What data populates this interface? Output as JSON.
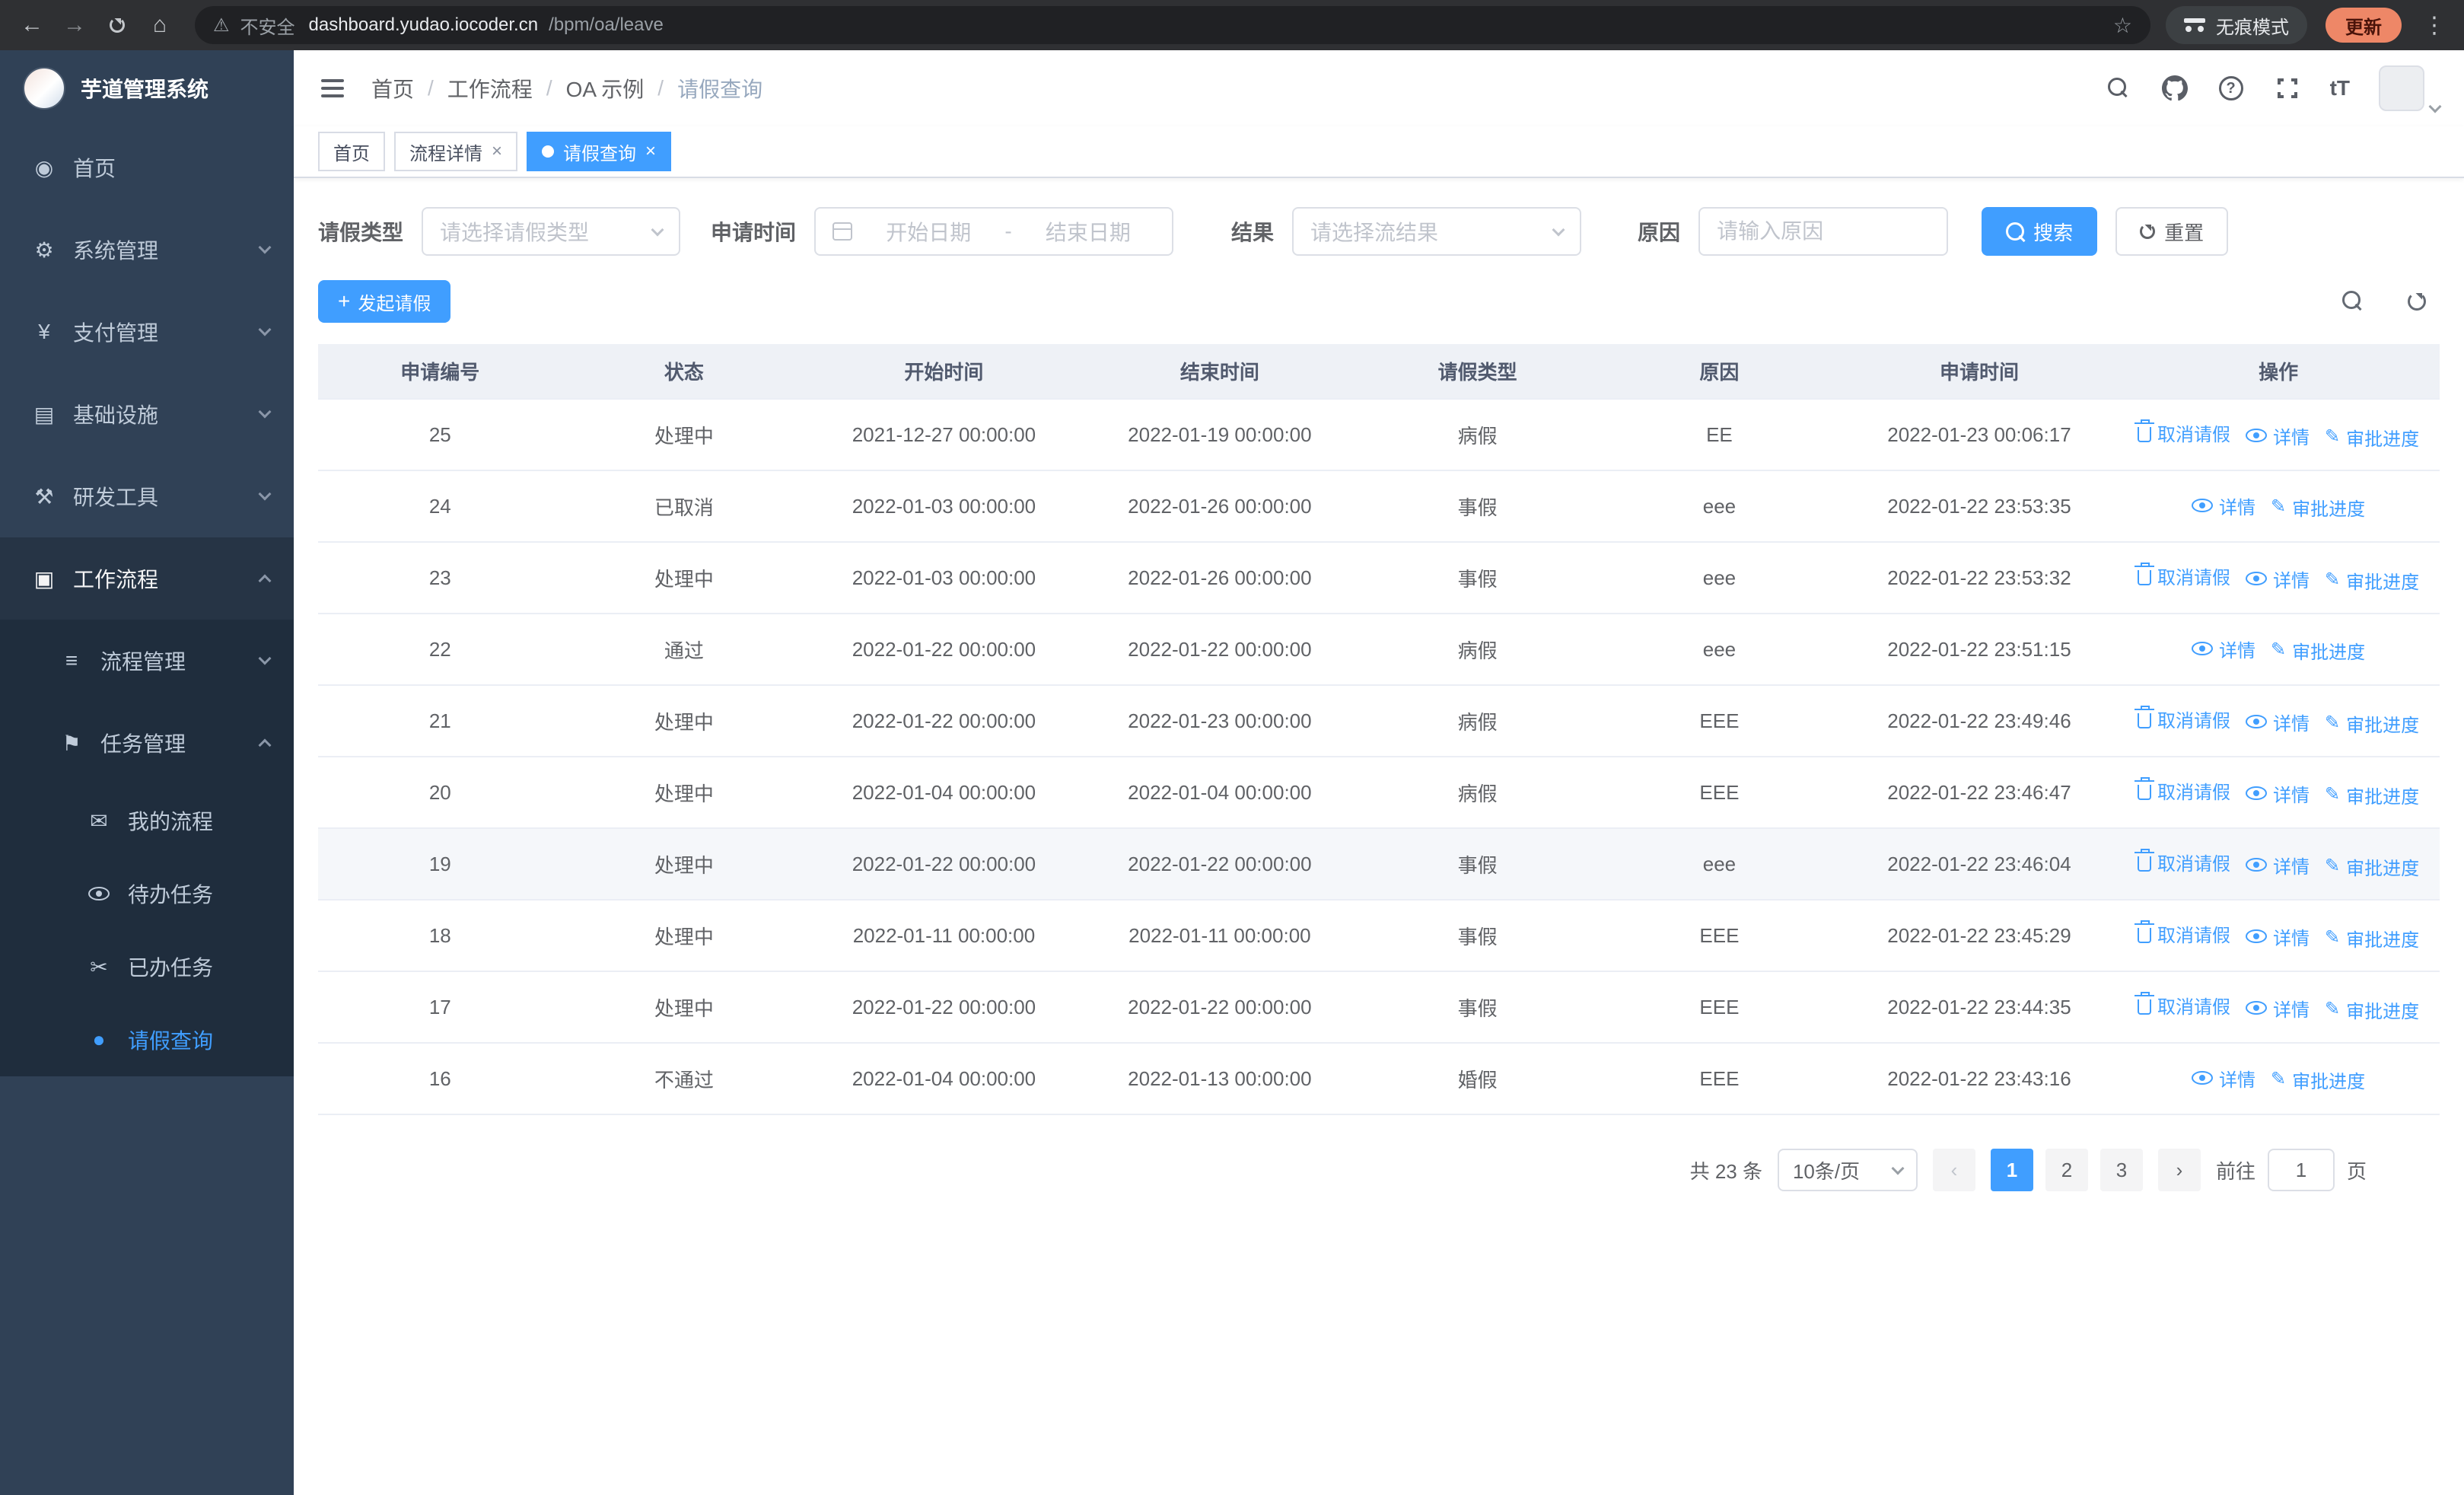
{
  "colors": {
    "primary": "#409eff",
    "sidebar_bg": "#304156",
    "sidebar_sub_bg": "#1f2d3d",
    "active_tab_bg": "#409eff",
    "table_header_bg": "#eef1f6"
  },
  "browser": {
    "security_label": "不安全",
    "url_host": "dashboard.yudao.iocoder.cn",
    "url_path": "/bpm/oa/leave",
    "incognito_label": "无痕模式",
    "update_label": "更新"
  },
  "sidebar": {
    "logo_title": "芋道管理系统",
    "items": [
      {
        "label": "首页",
        "icon": "dashboard-icon",
        "level": 1
      },
      {
        "label": "系统管理",
        "icon": "gear-icon",
        "level": 1,
        "arrow": "down"
      },
      {
        "label": "支付管理",
        "icon": "yen-icon",
        "level": 1,
        "arrow": "down"
      },
      {
        "label": "基础设施",
        "icon": "infrastructure-icon",
        "level": 1,
        "arrow": "down"
      },
      {
        "label": "研发工具",
        "icon": "tools-icon",
        "level": 1,
        "arrow": "down"
      },
      {
        "label": "工作流程",
        "icon": "workflow-icon",
        "level": 1,
        "arrow": "up",
        "open": true
      },
      {
        "label": "流程管理",
        "icon": "process-list-icon",
        "level": 2,
        "arrow": "down"
      },
      {
        "label": "任务管理",
        "icon": "task-flag-icon",
        "level": 2,
        "arrow": "up",
        "open": true
      },
      {
        "label": "我的流程",
        "icon": "chat-icon",
        "level": 3
      },
      {
        "label": "待办任务",
        "icon": "eye-icon",
        "level": 3
      },
      {
        "label": "已办任务",
        "icon": "scissors-icon",
        "level": 3
      },
      {
        "label": "请假查询",
        "icon": "user-icon",
        "level": 3,
        "active": true
      }
    ]
  },
  "navbar": {
    "breadcrumb": [
      "首页",
      "工作流程",
      "OA 示例",
      "请假查询"
    ],
    "separator": "/"
  },
  "tabs": [
    {
      "label": "首页",
      "closable": false,
      "active": false
    },
    {
      "label": "流程详情",
      "closable": true,
      "active": false
    },
    {
      "label": "请假查询",
      "closable": true,
      "active": true
    }
  ],
  "filters": {
    "leave_type_label": "请假类型",
    "leave_type_placeholder": "请选择请假类型",
    "apply_time_label": "申请时间",
    "start_date_placeholder": "开始日期",
    "range_separator": "-",
    "end_date_placeholder": "结束日期",
    "result_label": "结果",
    "result_placeholder": "请选择流结果",
    "reason_label": "原因",
    "reason_placeholder": "请输入原因",
    "search_label": "搜索",
    "reset_label": "重置"
  },
  "toolbar": {
    "create_label": "发起请假"
  },
  "table": {
    "columns": [
      "申请编号",
      "状态",
      "开始时间",
      "结束时间",
      "请假类型",
      "原因",
      "申请时间",
      "操作"
    ],
    "op_labels": {
      "cancel": "取消请假",
      "detail": "详情",
      "progress": "审批进度"
    },
    "rows": [
      {
        "id": "25",
        "status": "处理中",
        "start": "2021-12-27 00:00:00",
        "end": "2022-01-19 00:00:00",
        "type": "病假",
        "reason": "EE",
        "apply_time": "2022-01-23 00:06:17",
        "ops": [
          "cancel",
          "detail",
          "progress"
        ]
      },
      {
        "id": "24",
        "status": "已取消",
        "start": "2022-01-03 00:00:00",
        "end": "2022-01-26 00:00:00",
        "type": "事假",
        "reason": "eee",
        "apply_time": "2022-01-22 23:53:35",
        "ops": [
          "detail",
          "progress"
        ]
      },
      {
        "id": "23",
        "status": "处理中",
        "start": "2022-01-03 00:00:00",
        "end": "2022-01-26 00:00:00",
        "type": "事假",
        "reason": "eee",
        "apply_time": "2022-01-22 23:53:32",
        "ops": [
          "cancel",
          "detail",
          "progress"
        ]
      },
      {
        "id": "22",
        "status": "通过",
        "start": "2022-01-22 00:00:00",
        "end": "2022-01-22 00:00:00",
        "type": "病假",
        "reason": "eee",
        "apply_time": "2022-01-22 23:51:15",
        "ops": [
          "detail",
          "progress"
        ]
      },
      {
        "id": "21",
        "status": "处理中",
        "start": "2022-01-22 00:00:00",
        "end": "2022-01-23 00:00:00",
        "type": "病假",
        "reason": "EEE",
        "apply_time": "2022-01-22 23:49:46",
        "ops": [
          "cancel",
          "detail",
          "progress"
        ]
      },
      {
        "id": "20",
        "status": "处理中",
        "start": "2022-01-04 00:00:00",
        "end": "2022-01-04 00:00:00",
        "type": "病假",
        "reason": "EEE",
        "apply_time": "2022-01-22 23:46:47",
        "ops": [
          "cancel",
          "detail",
          "progress"
        ]
      },
      {
        "id": "19",
        "status": "处理中",
        "start": "2022-01-22 00:00:00",
        "end": "2022-01-22 00:00:00",
        "type": "事假",
        "reason": "eee",
        "apply_time": "2022-01-22 23:46:04",
        "ops": [
          "cancel",
          "detail",
          "progress"
        ],
        "hover": true
      },
      {
        "id": "18",
        "status": "处理中",
        "start": "2022-01-11 00:00:00",
        "end": "2022-01-11 00:00:00",
        "type": "事假",
        "reason": "EEE",
        "apply_time": "2022-01-22 23:45:29",
        "ops": [
          "cancel",
          "detail",
          "progress"
        ]
      },
      {
        "id": "17",
        "status": "处理中",
        "start": "2022-01-22 00:00:00",
        "end": "2022-01-22 00:00:00",
        "type": "事假",
        "reason": "EEE",
        "apply_time": "2022-01-22 23:44:35",
        "ops": [
          "cancel",
          "detail",
          "progress"
        ]
      },
      {
        "id": "16",
        "status": "不通过",
        "start": "2022-01-04 00:00:00",
        "end": "2022-01-13 00:00:00",
        "type": "婚假",
        "reason": "EEE",
        "apply_time": "2022-01-22 23:43:16",
        "ops": [
          "detail",
          "progress"
        ]
      }
    ]
  },
  "pagination": {
    "total_label": "共 23 条",
    "page_size": "10条/页",
    "pages": [
      "1",
      "2",
      "3"
    ],
    "active_page": "1",
    "goto_label": "前往",
    "goto_value": "1",
    "page_suffix": "页"
  }
}
